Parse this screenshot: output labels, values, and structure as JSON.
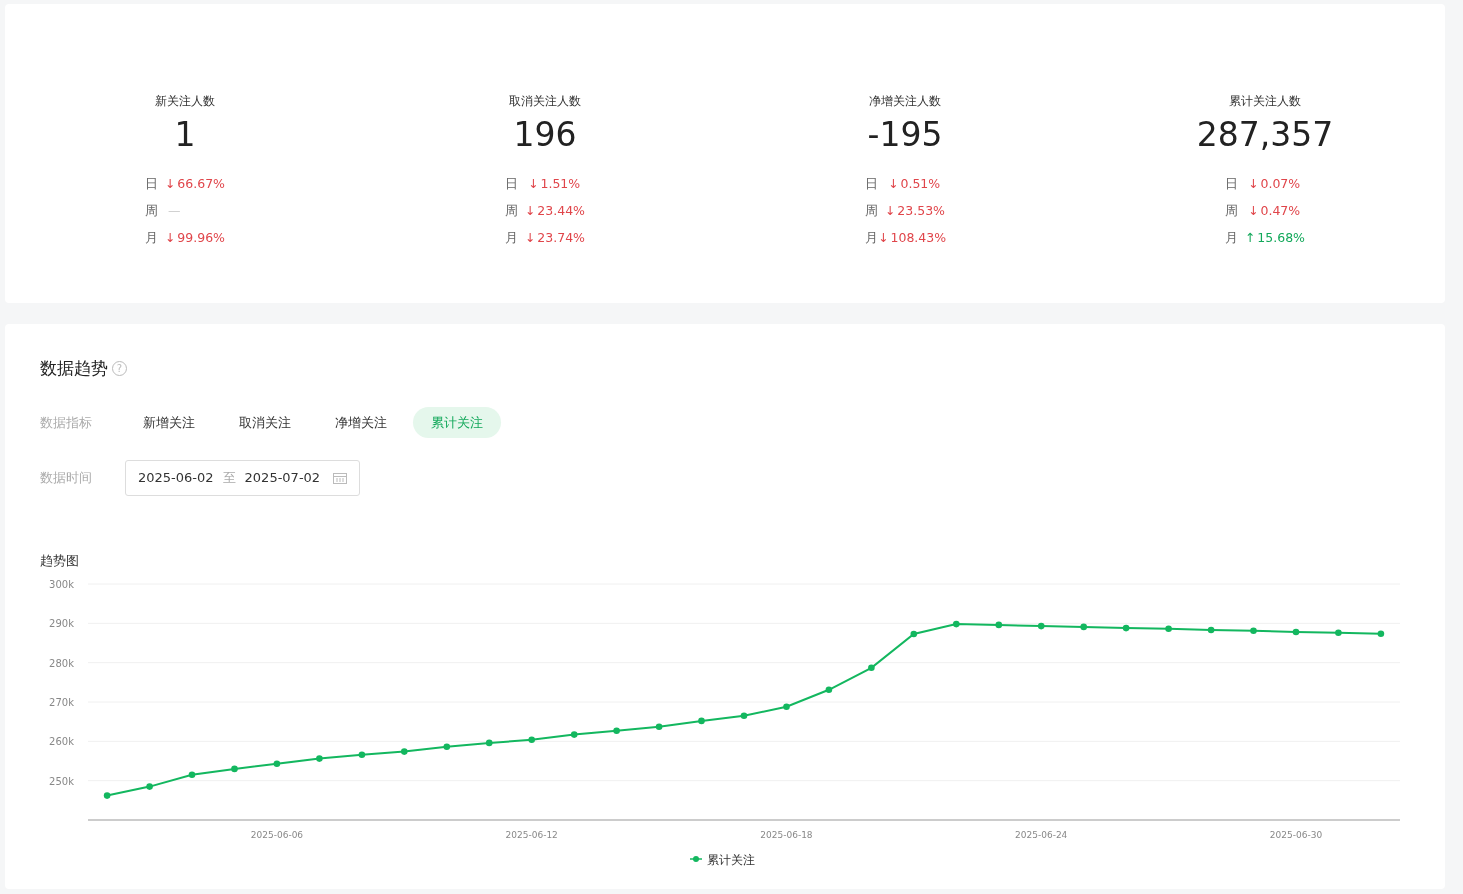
{
  "stats": [
    {
      "label": "新关注人数",
      "value": "1",
      "changes": [
        {
          "period": "日",
          "kind": "down",
          "arrow": "↓",
          "value": "66.67%"
        },
        {
          "period": "周",
          "kind": "none",
          "value": "—"
        },
        {
          "period": "月",
          "kind": "down",
          "arrow": "↓",
          "value": "99.96%"
        }
      ]
    },
    {
      "label": "取消关注人数",
      "value": "196",
      "changes": [
        {
          "period": "日",
          "kind": "down",
          "arrow": "↓",
          "value": "1.51%"
        },
        {
          "period": "周",
          "kind": "down",
          "arrow": "↓",
          "value": "23.44%"
        },
        {
          "period": "月",
          "kind": "down",
          "arrow": "↓",
          "value": "23.74%"
        }
      ]
    },
    {
      "label": "净增关注人数",
      "value": "-195",
      "changes": [
        {
          "period": "日",
          "kind": "down",
          "arrow": "↓",
          "value": "0.51%"
        },
        {
          "period": "周",
          "kind": "down",
          "arrow": "↓",
          "value": "23.53%"
        },
        {
          "period": "月",
          "kind": "down",
          "arrow": "↓",
          "value": "108.43%"
        }
      ]
    },
    {
      "label": "累计关注人数",
      "value": "287,357",
      "changes": [
        {
          "period": "日",
          "kind": "down",
          "arrow": "↓",
          "value": "0.07%"
        },
        {
          "period": "周",
          "kind": "down",
          "arrow": "↓",
          "value": "0.47%"
        },
        {
          "period": "月",
          "kind": "up",
          "arrow": "↑",
          "value": "15.68%"
        }
      ]
    }
  ],
  "trend": {
    "title": "数据趋势",
    "help_icon": "?",
    "indicator_label": "数据指标",
    "indicators": [
      {
        "label": "新增关注",
        "selected": false
      },
      {
        "label": "取消关注",
        "selected": false
      },
      {
        "label": "净增关注",
        "selected": false
      },
      {
        "label": "累计关注",
        "selected": true
      }
    ],
    "time_label": "数据时间",
    "date_range": {
      "start": "2025-06-02",
      "separator": "至",
      "end": "2025-07-02"
    },
    "chart_title": "趋势图",
    "chart_data": {
      "type": "line",
      "grid": true,
      "categories": [
        null,
        null,
        null,
        null,
        "2025-06-06",
        null,
        null,
        null,
        null,
        null,
        "2025-06-12",
        null,
        null,
        null,
        null,
        null,
        "2025-06-18",
        null,
        null,
        null,
        null,
        null,
        "2025-06-24",
        null,
        null,
        null,
        null,
        null,
        "2025-06-30",
        null,
        null
      ],
      "series": [
        {
          "name": "累计关注",
          "color": "#13b75f",
          "marker": true,
          "values": [
            246200,
            248500,
            251500,
            253000,
            254300,
            255600,
            256600,
            257400,
            258600,
            259600,
            260400,
            261700,
            262700,
            263700,
            265200,
            266500,
            268800,
            273100,
            278700,
            287300,
            289800,
            289600,
            289300,
            289100,
            288800,
            288600,
            288300,
            288100,
            287800,
            287600,
            287357
          ]
        }
      ],
      "ylim": [
        240000,
        300000
      ],
      "yticks": [
        {
          "value": 250000,
          "label": "250k"
        },
        {
          "value": 260000,
          "label": "260k"
        },
        {
          "value": 270000,
          "label": "270k"
        },
        {
          "value": 280000,
          "label": "280k"
        },
        {
          "value": 290000,
          "label": "290k"
        },
        {
          "value": 300000,
          "label": "300k"
        }
      ]
    }
  }
}
